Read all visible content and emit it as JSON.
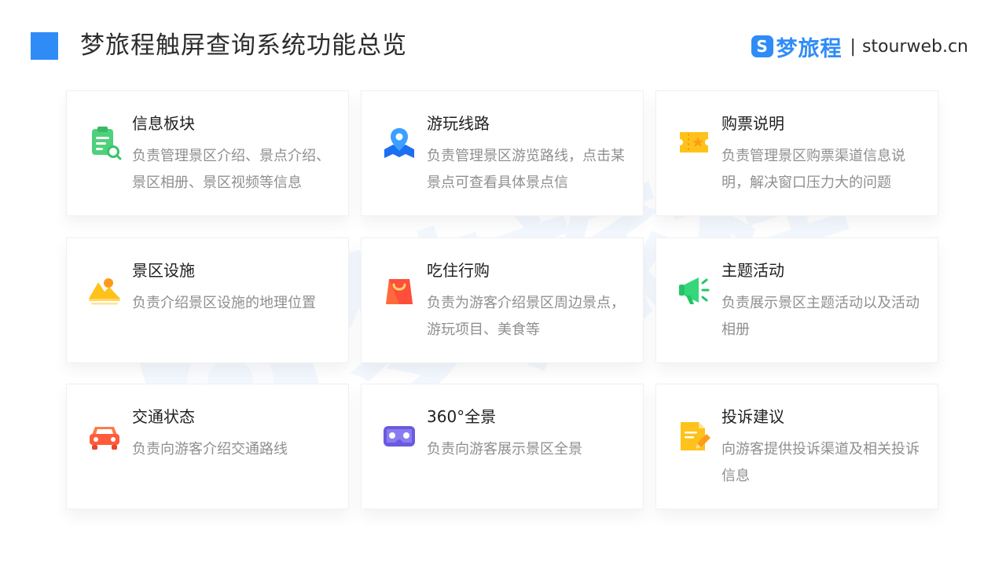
{
  "header": {
    "title": "梦旅程触屏查询系统功能总览",
    "brand_name": "梦旅程",
    "brand_separator": "|",
    "brand_url": "stourweb.cn",
    "brand_logo_letter": "S"
  },
  "watermark": {
    "text": "梦旅程"
  },
  "colors": {
    "accent": "#2f8cf7",
    "title_text": "#2d2d2d",
    "card_title": "#1f1f1f",
    "card_desc": "#8f8f8f"
  },
  "cards": [
    {
      "title": "信息板块",
      "desc": "负责管理景区介绍、景点介绍、景区相册、景区视频等信息",
      "icon": "clipboard-search-icon"
    },
    {
      "title": "游玩线路",
      "desc": "负责管理景区游览路线，点击某景点可查看具体景点信",
      "icon": "map-pin-icon"
    },
    {
      "title": "购票说明",
      "desc": "负责管理景区购票渠道信息说明，解决窗口压力大的问题",
      "icon": "ticket-icon"
    },
    {
      "title": "景区设施",
      "desc": "负责介绍景区设施的地理位置",
      "icon": "landscape-icon"
    },
    {
      "title": "吃住行购",
      "desc": "负责为游客介绍景区周边景点，游玩项目、美食等",
      "icon": "shopping-bag-icon"
    },
    {
      "title": "主题活动",
      "desc": "负责展示景区主题活动以及活动相册",
      "icon": "megaphone-icon"
    },
    {
      "title": "交通状态",
      "desc": "负责向游客介绍交通路线",
      "icon": "car-icon"
    },
    {
      "title": "360°全景",
      "desc": "负责向游客展示景区全景",
      "icon": "vr-headset-icon"
    },
    {
      "title": "投诉建议",
      "desc": "向游客提供投诉渠道及相关投诉信息",
      "icon": "document-pen-icon"
    }
  ]
}
